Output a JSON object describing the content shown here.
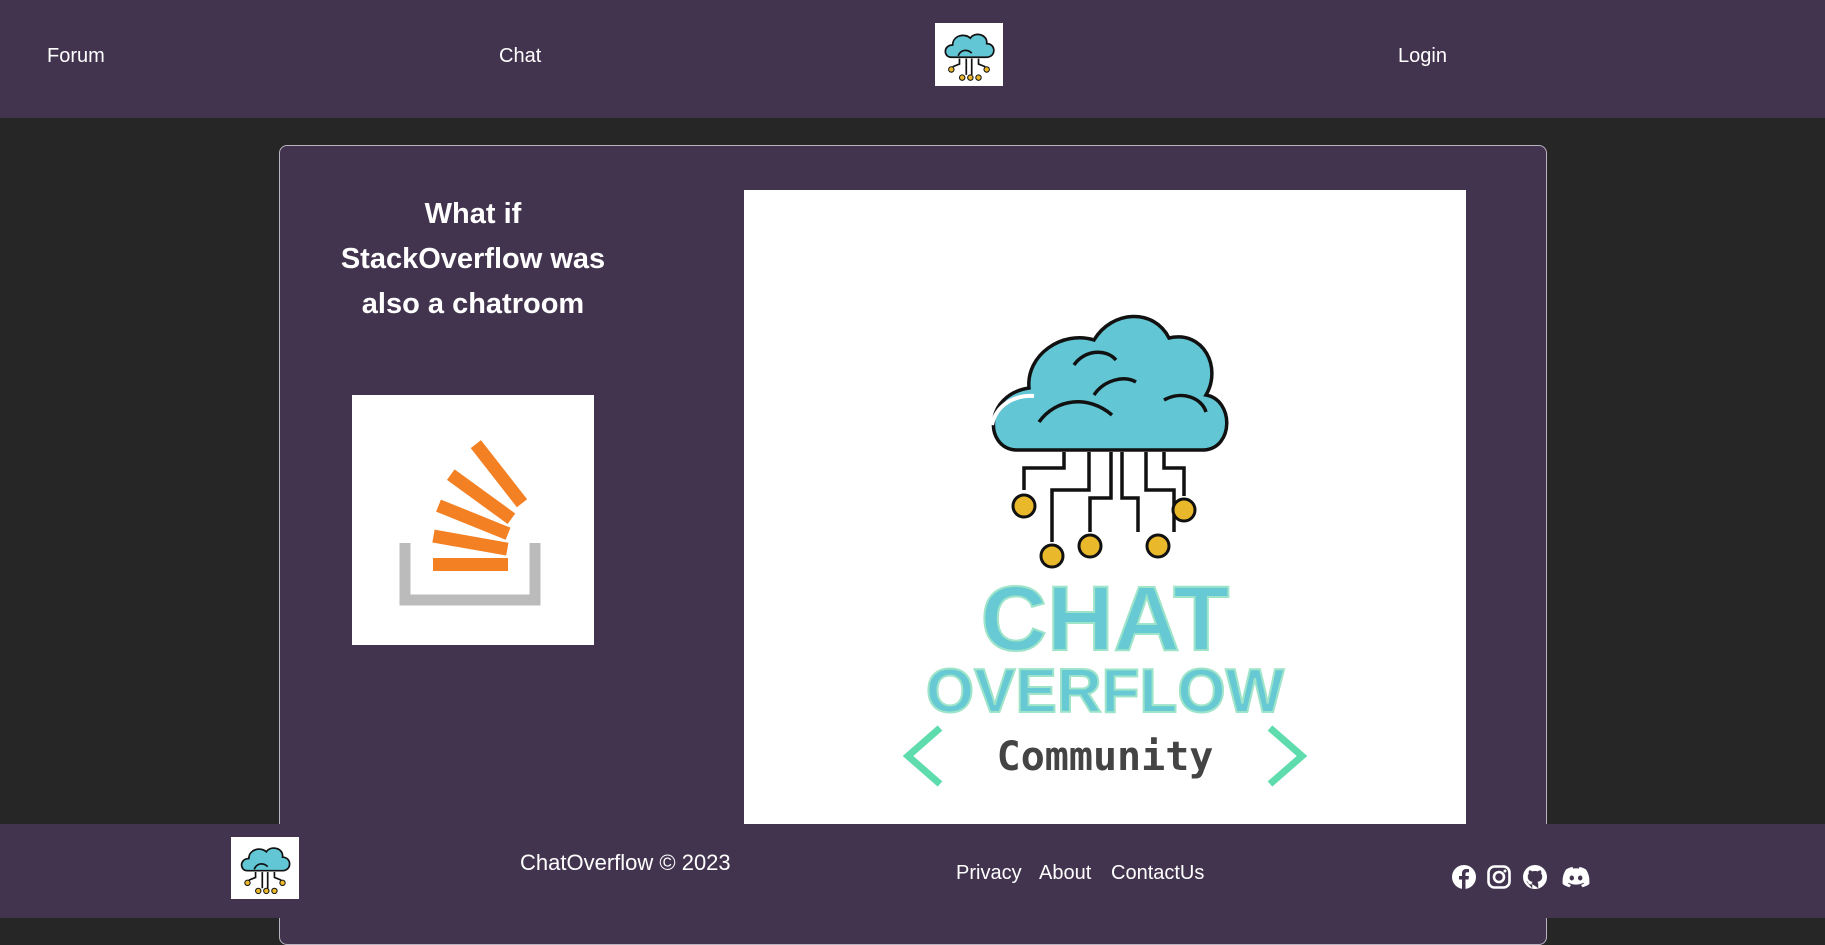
{
  "header": {
    "nav": [
      {
        "label": "Forum"
      },
      {
        "label": "Chat"
      }
    ],
    "login_label": "Login",
    "logo_icon": "chatoverflow-cloud-logo"
  },
  "main": {
    "tagline": "What if StackOverflow was also a chatroom",
    "stackoverflow_icon": "stackoverflow-logo",
    "hero_logo": {
      "title": "CHAT",
      "subtitle": "OVERFLOW",
      "community": "Community"
    }
  },
  "footer": {
    "copyright": "ChatOverflow © 2023",
    "links": [
      {
        "label": "Privacy"
      },
      {
        "label": "About"
      },
      {
        "label": "ContactUs"
      }
    ],
    "social_icons": [
      "facebook-icon",
      "instagram-icon",
      "github-icon",
      "discord-icon"
    ]
  },
  "colors": {
    "panel": "#42344e",
    "background": "#262626",
    "cloud": "#62c6d4",
    "accent_orange": "#f48024",
    "logo_text": "#67c9d3"
  }
}
